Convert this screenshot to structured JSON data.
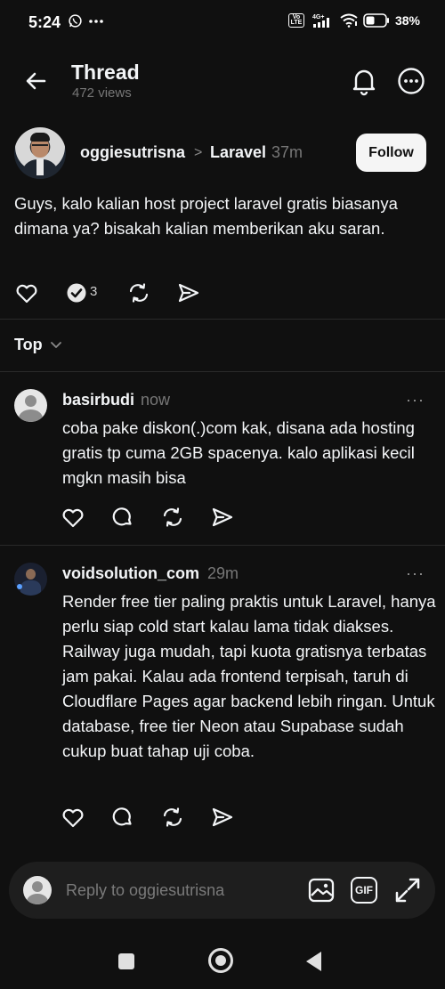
{
  "status_bar": {
    "time": "5:24",
    "left_icons": [
      "whatsapp-icon",
      "more-dots-icon"
    ],
    "network": "4G+",
    "volte": "Vo LTE",
    "battery_percent": "38%"
  },
  "header": {
    "title": "Thread",
    "views": "472 views",
    "icons": [
      "back-arrow-icon",
      "bell-icon",
      "more-circle-icon"
    ]
  },
  "post": {
    "author": "oggiesutrisna",
    "separator": ">",
    "topic": "Laravel",
    "time": "37m",
    "follow_label": "Follow",
    "text": "Guys, kalo kalian host project laravel gratis biasanya dimana ya? bisakah kalian memberikan aku saran.",
    "reply_count": "3"
  },
  "sort": {
    "label": "Top"
  },
  "replies": [
    {
      "author": "basirbudi",
      "time": "now",
      "more": "···",
      "text": "coba pake diskon(.)com kak, disana ada hosting gratis tp cuma 2GB spacenya. kalo aplikasi kecil mgkn masih bisa"
    },
    {
      "author": "voidsolution_com",
      "time": "29m",
      "more": "···",
      "text": "Render free tier paling praktis untuk Laravel, hanya perlu siap cold start kalau lama tidak diakses. Railway juga mudah, tapi kuota gratisnya terbatas jam pakai. Kalau ada frontend terpisah, taruh di Cloudflare Pages agar backend lebih ringan. Untuk database, free tier Neon atau Supabase sudah cukup buat tahap uji coba."
    }
  ],
  "reply_bar": {
    "placeholder": "Reply to oggiesutrisna",
    "gif_label": "GIF"
  },
  "colors": {
    "background": "#101010",
    "text": "#f3f5f7",
    "muted": "#777777",
    "follow_bg": "#f5f5f5"
  }
}
